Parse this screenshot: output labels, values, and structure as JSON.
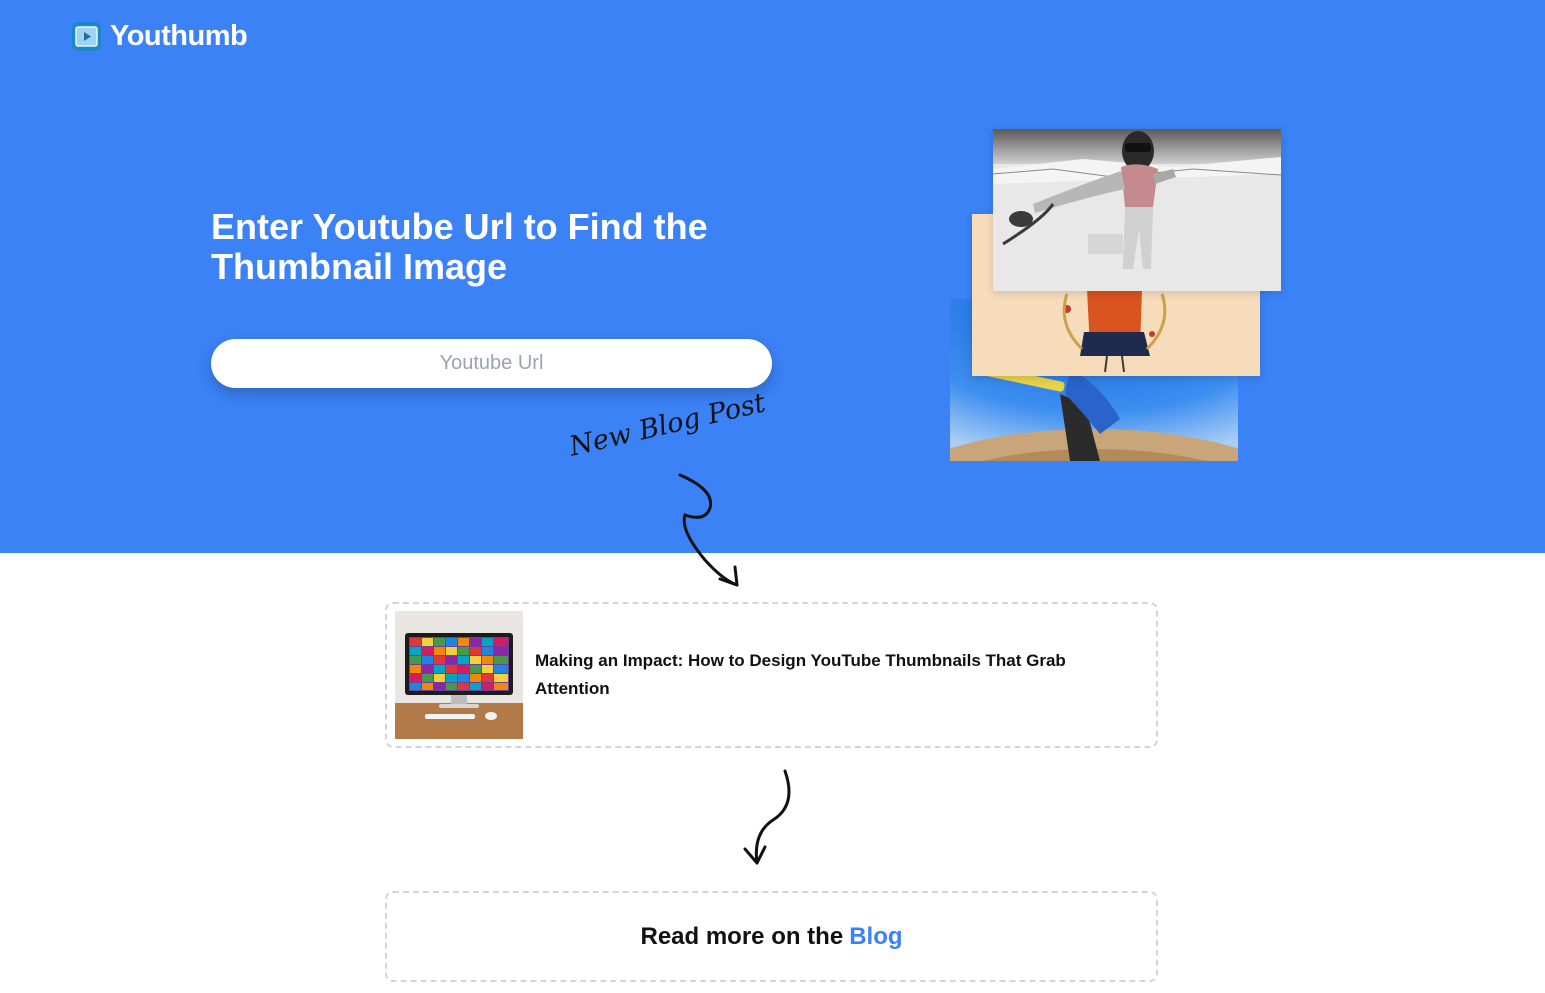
{
  "brand": {
    "name": "Youthumb",
    "icon": "play-thumbnail-icon"
  },
  "hero": {
    "headline_line1": "Enter Youtube Url to Find the",
    "headline_line2": "Thumbnail Image",
    "input_placeholder": "Youtube Url",
    "input_value": ""
  },
  "annotation": {
    "label": "New Blog Post"
  },
  "blog_post": {
    "title": "Making an Impact: How to Design YouTube Thumbnails That Grab Attention"
  },
  "read_more": {
    "prefix": "Read more on the",
    "link_label": "Blog"
  },
  "colors": {
    "accent": "#3b82f6",
    "white": "#ffffff",
    "border": "#d1d5db",
    "text": "#111111"
  }
}
